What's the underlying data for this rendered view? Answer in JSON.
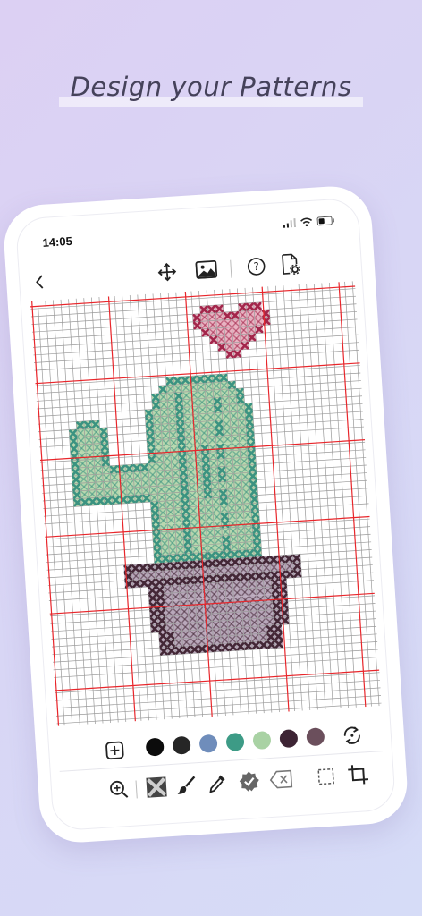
{
  "headline": "Design your Patterns",
  "status_bar": {
    "time": "14:05"
  },
  "toolbar": {
    "icons": [
      "move-arrows-icon",
      "image-icon",
      "help-icon",
      "document-settings-icon"
    ]
  },
  "palette": {
    "colors": [
      "#0c0c0c",
      "#262626",
      "#6f8dbb",
      "#3d9b86",
      "#a9d2a4",
      "#3d2434",
      "#6b4f5c"
    ]
  },
  "tools": [
    "zoom-in-icon",
    "cross-stitch-icon",
    "brush-icon",
    "eyedropper-icon",
    "verified-badge-icon",
    "erase-icon",
    "select-icon",
    "crop-icon"
  ],
  "pattern": {
    "colors": {
      "heart_outline": "#a3264b",
      "heart_fill": "#e9b3c2",
      "cactus_outline": "#3b9381",
      "cactus_fill": "#b8d7ae",
      "pot_outline": "#432736",
      "pot_fill": "#b9a8bb",
      "grid_line": "#9a9a9a",
      "grid_major": "#e8262b"
    }
  }
}
